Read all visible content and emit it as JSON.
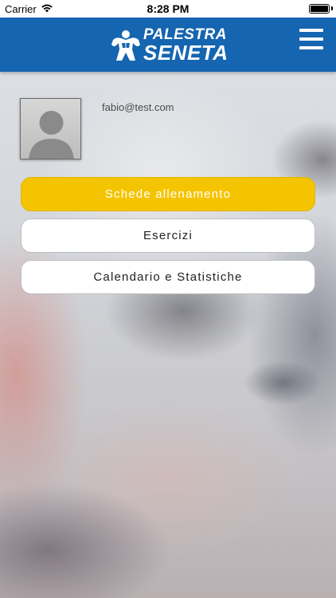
{
  "status_bar": {
    "carrier": "Carrier",
    "time": "8:28 PM"
  },
  "header": {
    "logo_line1": "PALESTRA",
    "logo_line2": "SENETA",
    "color": "#1565b0",
    "menu_icon": "hamburger-menu-icon"
  },
  "profile": {
    "email": "fabio@test.com",
    "avatar_icon": "default-user-avatar-icon"
  },
  "buttons": {
    "schede": "Schede allenamento",
    "esercizi": "Esercizi",
    "calendario": "Calendario e Statistiche"
  },
  "colors": {
    "accent": "#f5c400",
    "button_bg": "#ffffff"
  }
}
